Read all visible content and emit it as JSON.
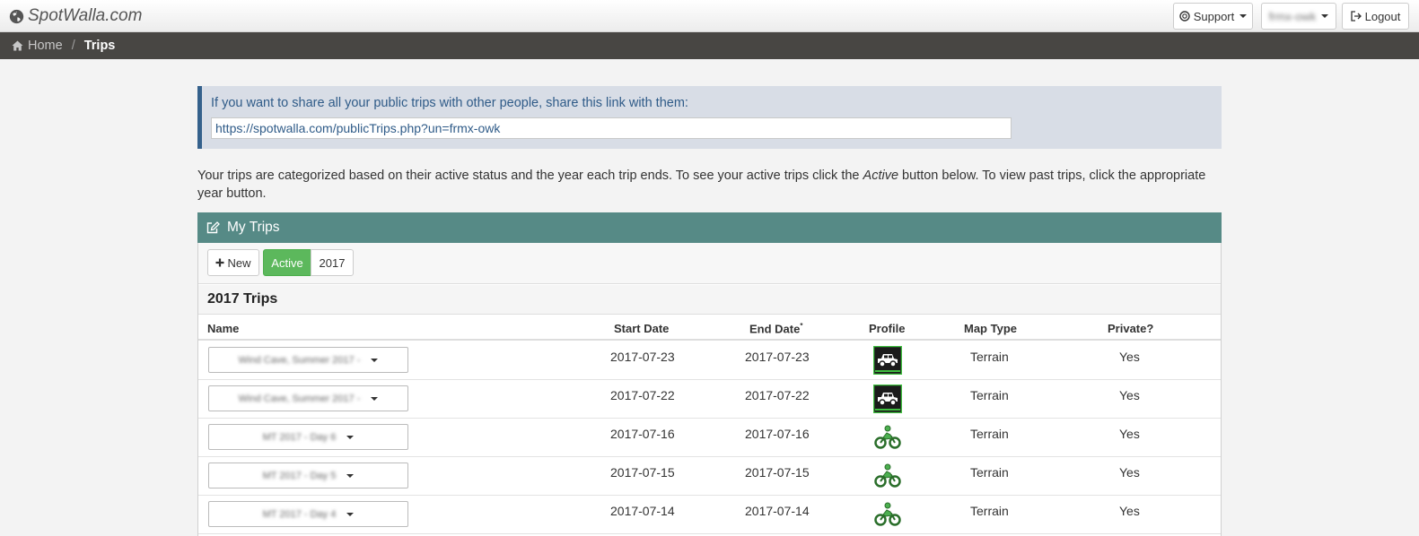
{
  "header": {
    "brand": "SpotWalla.com",
    "support_label": "Support",
    "user_label": "frmx-owk",
    "logout_label": "Logout"
  },
  "breadcrumb": {
    "home": "Home",
    "separator": "/",
    "current": "Trips"
  },
  "share": {
    "text": "If you want to share all your public trips with other people, share this link with them:",
    "link": "https://spotwalla.com/publicTrips.php?un=frmx-owk"
  },
  "intro": {
    "part1": "Your trips are categorized based on their active status and the year each trip ends. To see your active trips click the ",
    "active_word": "Active",
    "part2": " button below. To view past trips, click the appropriate year button."
  },
  "panel": {
    "title": "My Trips",
    "new_label": "New",
    "active_label": "Active",
    "year_label": "2017",
    "section_title": "2017 Trips"
  },
  "table": {
    "headers": {
      "name": "Name",
      "start": "Start Date",
      "end": "End Date",
      "end_mark": "*",
      "profile": "Profile",
      "map": "Map Type",
      "private": "Private?"
    },
    "rows": [
      {
        "name": "Wind Cave, Summer 2017 -",
        "start": "2017-07-23",
        "end": "2017-07-23",
        "profile": "truck-icon",
        "map": "Terrain",
        "private": "Yes"
      },
      {
        "name": "Wind Cave, Summer 2017 -",
        "start": "2017-07-22",
        "end": "2017-07-22",
        "profile": "truck-icon",
        "map": "Terrain",
        "private": "Yes"
      },
      {
        "name": "MT 2017 - Day 6",
        "start": "2017-07-16",
        "end": "2017-07-16",
        "profile": "motorcycle-icon",
        "map": "Terrain",
        "private": "Yes"
      },
      {
        "name": "MT 2017 - Day 5",
        "start": "2017-07-15",
        "end": "2017-07-15",
        "profile": "motorcycle-icon",
        "map": "Terrain",
        "private": "Yes"
      },
      {
        "name": "MT 2017 - Day 4",
        "start": "2017-07-14",
        "end": "2017-07-14",
        "profile": "motorcycle-icon",
        "map": "Terrain",
        "private": "Yes"
      }
    ]
  },
  "colors": {
    "panel_header": "#568a86",
    "active_button": "#5cb85c",
    "breadcrumb_bar": "#484643",
    "share_accent": "#35618c",
    "profile_green": "#3f9e3f"
  }
}
